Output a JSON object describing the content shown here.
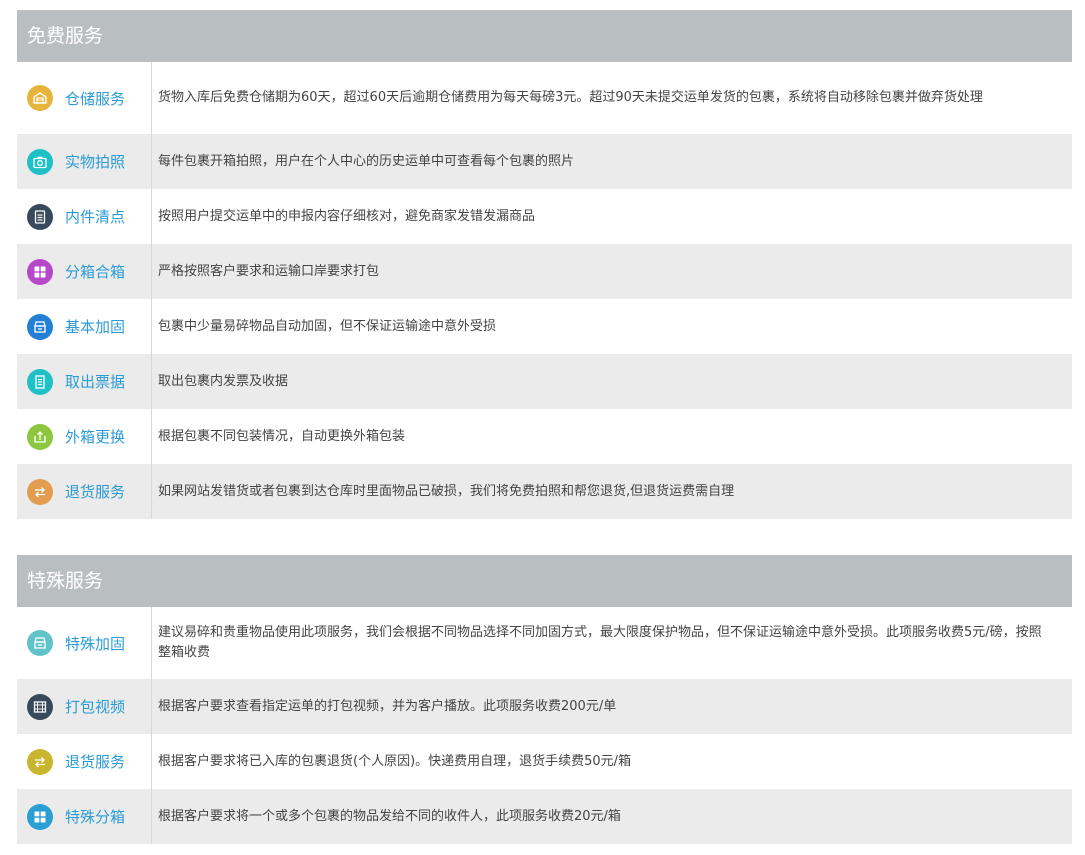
{
  "sections": [
    {
      "title": "免费服务",
      "items": [
        {
          "label": "仓储服务",
          "icon": "warehouse-icon",
          "color": "#e8b33a",
          "desc": "货物入库后免费仓储期为60天，超过60天后逾期仓储费用为每天每磅3元。超过90天未提交运单发货的包裹，系统将自动移除包裹并做弃货处理"
        },
        {
          "label": "实物拍照",
          "icon": "camera-icon",
          "color": "#1fc1c6",
          "desc": "每件包裹开箱拍照，用户在个人中心的历史运单中可查看每个包裹的照片"
        },
        {
          "label": "内件清点",
          "icon": "document-icon",
          "color": "#37495a",
          "desc": "按照用户提交运单中的申报内容仔细核对，避免商家发错发漏商品"
        },
        {
          "label": "分箱合箱",
          "icon": "grid-icon",
          "color": "#b549c9",
          "desc": "严格按照客户要求和运输口岸要求打包"
        },
        {
          "label": "基本加固",
          "icon": "box-icon",
          "color": "#2380d6",
          "desc": "包裹中少量易碎物品自动加固，但不保证运输途中意外受损"
        },
        {
          "label": "取出票据",
          "icon": "receipt-icon",
          "color": "#1fc1c6",
          "desc": "取出包裹内发票及收据"
        },
        {
          "label": "外箱更换",
          "icon": "package-swap-icon",
          "color": "#8dc63f",
          "desc": "根据包裹不同包装情况，自动更换外箱包装"
        },
        {
          "label": "退货服务",
          "icon": "return-icon",
          "color": "#e39d4e",
          "desc": "如果网站发错货或者包裹到达仓库时里面物品已破损，我们将免费拍照和帮您退货,但退货运费需自理"
        }
      ]
    },
    {
      "title": "特殊服务",
      "items": [
        {
          "label": "特殊加固",
          "icon": "box-icon",
          "color": "#5fc3c9",
          "desc": "建议易碎和贵重物品使用此项服务，我们会根据不同物品选择不同加固方式，最大限度保护物品，但不保证运输途中意外受损。此项服务收费5元/磅，按照整箱收费"
        },
        {
          "label": "打包视频",
          "icon": "video-icon",
          "color": "#37495a",
          "desc": "根据客户要求查看指定运单的打包视频，并为客户播放。此项服务收费200元/单"
        },
        {
          "label": "退货服务",
          "icon": "return-icon",
          "color": "#c9b52e",
          "desc": "根据客户要求将已入库的包裹退货(个人原因)。快递费用自理，退货手续费50元/箱"
        },
        {
          "label": "特殊分箱",
          "icon": "grid-icon",
          "color": "#2a9fd4",
          "desc": "根据客户要求将一个或多个包裹的物品发给不同的收件人，此项服务收费20元/箱"
        }
      ]
    }
  ]
}
